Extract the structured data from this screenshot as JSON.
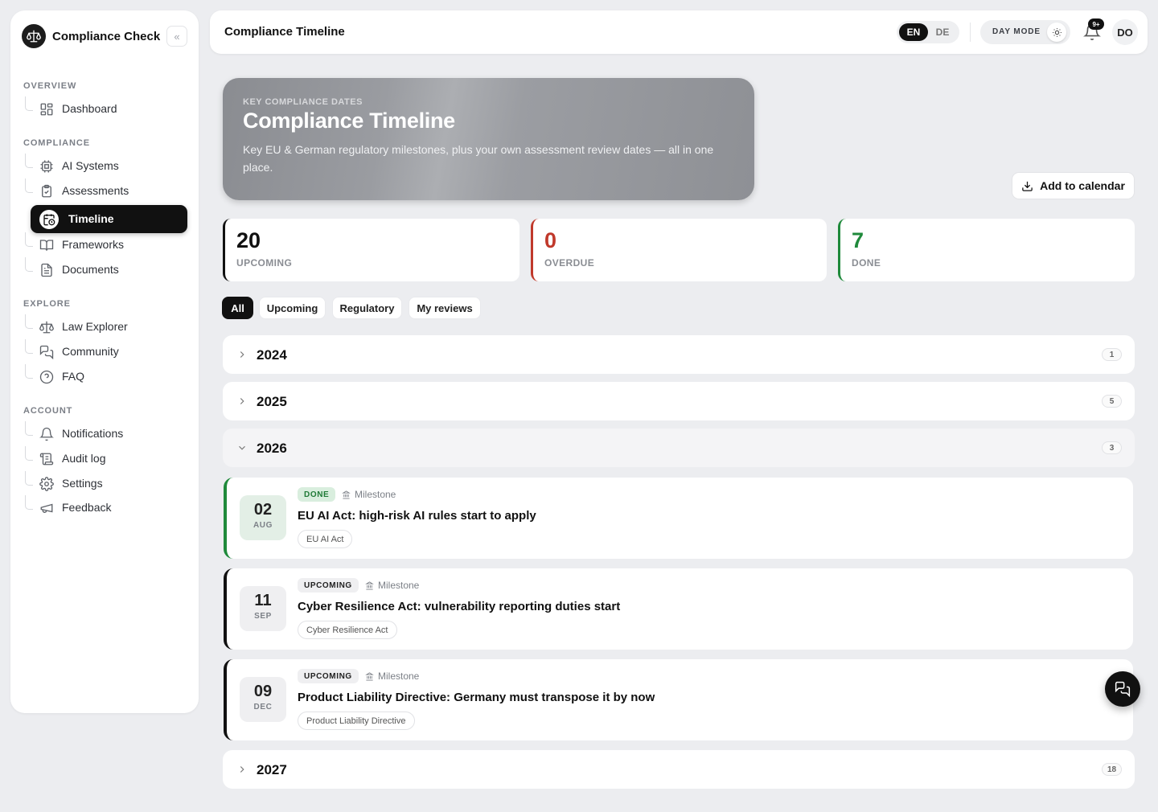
{
  "sidebar": {
    "brand": "Compliance Check",
    "collapse_icon": "chevrons-left-icon",
    "sections": {
      "overview": "OVERVIEW",
      "compliance": "COMPLIANCE",
      "explore": "EXPLORE",
      "account": "ACCOUNT"
    },
    "items": {
      "dashboard": "Dashboard",
      "ai_systems": "AI Systems",
      "assessments": "Assessments",
      "timeline": "Timeline",
      "frameworks": "Frameworks",
      "documents": "Documents",
      "law_explorer": "Law Explorer",
      "community": "Community",
      "faq": "FAQ",
      "notifications": "Notifications",
      "audit_log": "Audit log",
      "settings": "Settings",
      "feedback": "Feedback"
    },
    "active_item": "timeline"
  },
  "topbar": {
    "title": "Compliance Timeline",
    "lang_en": "EN",
    "lang_de": "DE",
    "active_lang": "EN",
    "mode_label": "DAY MODE",
    "notif_badge": "9+",
    "avatar": "DO"
  },
  "hero": {
    "eyebrow": "KEY COMPLIANCE DATES",
    "title": "Compliance Timeline",
    "description": "Key EU & German regulatory milestones, plus your own assessment review dates — all in one place."
  },
  "add_calendar": "Add to calendar",
  "stats": {
    "upcoming": {
      "value": "20",
      "label": "UPCOMING",
      "color": "#111111"
    },
    "overdue": {
      "value": "0",
      "label": "OVERDUE",
      "color": "#c0392b"
    },
    "done": {
      "value": "7",
      "label": "DONE",
      "color": "#1f8a3b"
    }
  },
  "filters": {
    "all": "All",
    "upcoming": "Upcoming",
    "regulatory": "Regulatory",
    "my_reviews": "My reviews",
    "active": "All"
  },
  "years": {
    "y2024": {
      "label": "2024",
      "count": "1",
      "expanded": false
    },
    "y2025": {
      "label": "2025",
      "count": "5",
      "expanded": false
    },
    "y2026": {
      "label": "2026",
      "count": "3",
      "expanded": true
    },
    "y2027": {
      "label": "2027",
      "count": "18",
      "expanded": false
    }
  },
  "events": [
    {
      "day": "02",
      "month": "AUG",
      "status": "DONE",
      "type": "Milestone",
      "title": "EU AI Act: high-risk AI rules start to apply",
      "tag": "EU AI Act"
    },
    {
      "day": "11",
      "month": "SEP",
      "status": "UPCOMING",
      "type": "Milestone",
      "title": "Cyber Resilience Act: vulnerability reporting duties start",
      "tag": "Cyber Resilience Act"
    },
    {
      "day": "09",
      "month": "DEC",
      "status": "UPCOMING",
      "type": "Milestone",
      "title": "Product Liability Directive: Germany must transpose it by now",
      "tag": "Product Liability Directive"
    }
  ],
  "colors": {
    "accent": "#111111",
    "done": "#1f8a3b",
    "overdue": "#c0392b",
    "background": "#ecedf0"
  }
}
